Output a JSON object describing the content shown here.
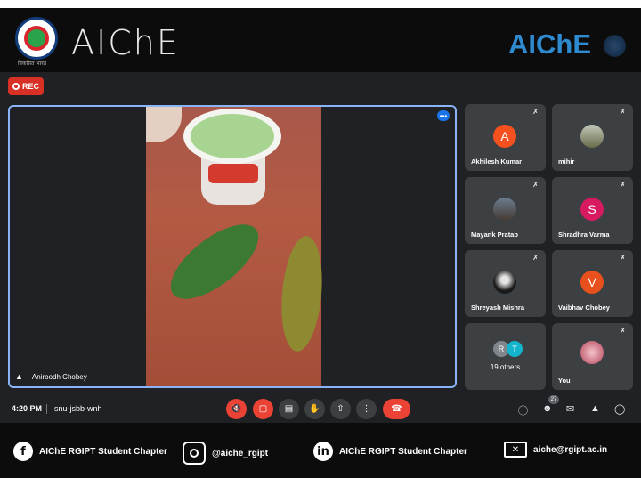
{
  "header": {
    "logo_caption": "विकसित भारत",
    "left_brand": "AIChE",
    "right_brand": "AIChE"
  },
  "meeting": {
    "rec_label": "REC",
    "presenter": {
      "name": "Aniroodh Chobey"
    },
    "participants": [
      {
        "name": "Akhilesh Kumar",
        "initial": "A",
        "avatar_color": "#f4511e",
        "muted": true
      },
      {
        "name": "mihir",
        "initial": "",
        "avatar_color": "",
        "muted": true
      },
      {
        "name": "Mayank Pratap",
        "initial": "",
        "avatar_color": "",
        "muted": true
      },
      {
        "name": "Shradhra Varma",
        "initial": "S",
        "avatar_color": "#d81b60",
        "muted": true
      },
      {
        "name": "Shreyash Mishra",
        "initial": "",
        "avatar_color": "",
        "muted": true
      },
      {
        "name": "Vaibhav Chobey",
        "initial": "V",
        "avatar_color": "#e8501e",
        "muted": true
      },
      {
        "name": "You",
        "initial": "",
        "avatar_color": "",
        "muted": true
      }
    ],
    "others": {
      "label": "19 others",
      "initials": [
        "R",
        "T"
      ],
      "colors": [
        "#80868b",
        "#12b5cb"
      ]
    },
    "time": "4:20 PM",
    "code": "snu-jsbb-wnh",
    "people_count": "27"
  },
  "icons": {
    "rec": "record-icon",
    "pin": "pin-icon",
    "mic_off": "mic-off-icon",
    "cam_off": "camera-off-icon",
    "captions": "captions-icon",
    "hand": "raise-hand-icon",
    "present": "present-icon",
    "more": "more-icon",
    "hangup": "hangup-icon",
    "info": "info-icon",
    "people": "people-icon",
    "chat": "chat-icon",
    "activities": "activities-icon",
    "host": "host-controls-icon"
  },
  "footer": {
    "facebook": "AIChE RGIPT Student Chapter",
    "instagram": "@aiche_rgipt",
    "linkedin": "AIChE RGIPT Student Chapter",
    "email": "aiche@rgipt.ac.in"
  },
  "colors": {
    "accent": "#8ab4f8",
    "danger": "#ea4335",
    "brand": "#2e8bd0",
    "tile": "#3c4043",
    "bg": "#202124"
  }
}
